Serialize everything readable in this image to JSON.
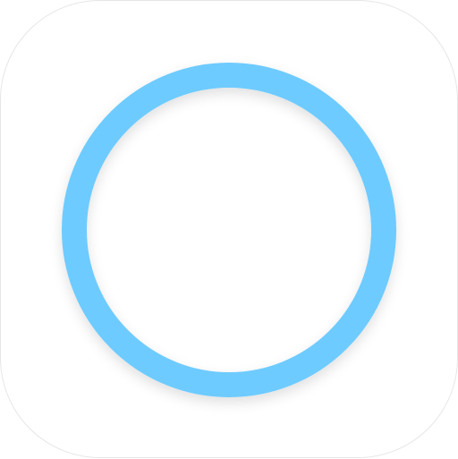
{
  "app_icon": {
    "icon": "ring-icon",
    "colors": {
      "background": "#ffffff",
      "border": "#e6e6e6",
      "ring": "#6ecbff",
      "shadow": "#000000"
    }
  }
}
